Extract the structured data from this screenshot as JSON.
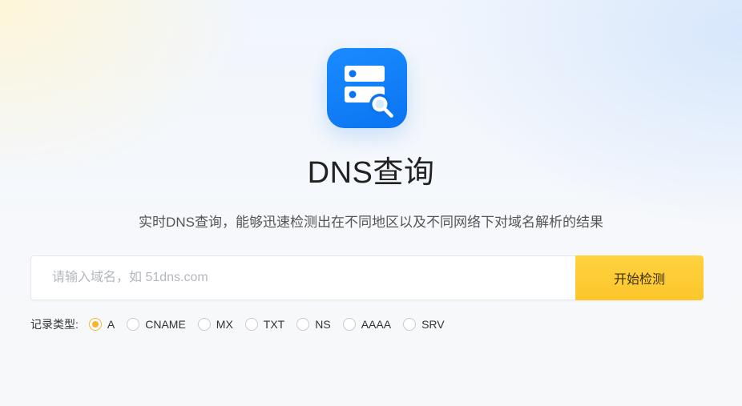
{
  "page": {
    "title": "DNS查询",
    "subtitle": "实时DNS查询，能够迅速检测出在不同地区以及不同网络下对域名解析的结果",
    "logo_icon": "dns-server-search-icon",
    "accent_color": "#0a74f0",
    "button_color": "#fcc62c"
  },
  "search": {
    "placeholder": "请输入域名，如 51dns.com",
    "value": "",
    "button_label": "开始检测"
  },
  "record_types": {
    "label": "记录类型:",
    "selected": "A",
    "options": [
      {
        "label": "A",
        "checked": true
      },
      {
        "label": "CNAME",
        "checked": false
      },
      {
        "label": "MX",
        "checked": false
      },
      {
        "label": "TXT",
        "checked": false
      },
      {
        "label": "NS",
        "checked": false
      },
      {
        "label": "AAAA",
        "checked": false
      },
      {
        "label": "SRV",
        "checked": false
      }
    ]
  }
}
